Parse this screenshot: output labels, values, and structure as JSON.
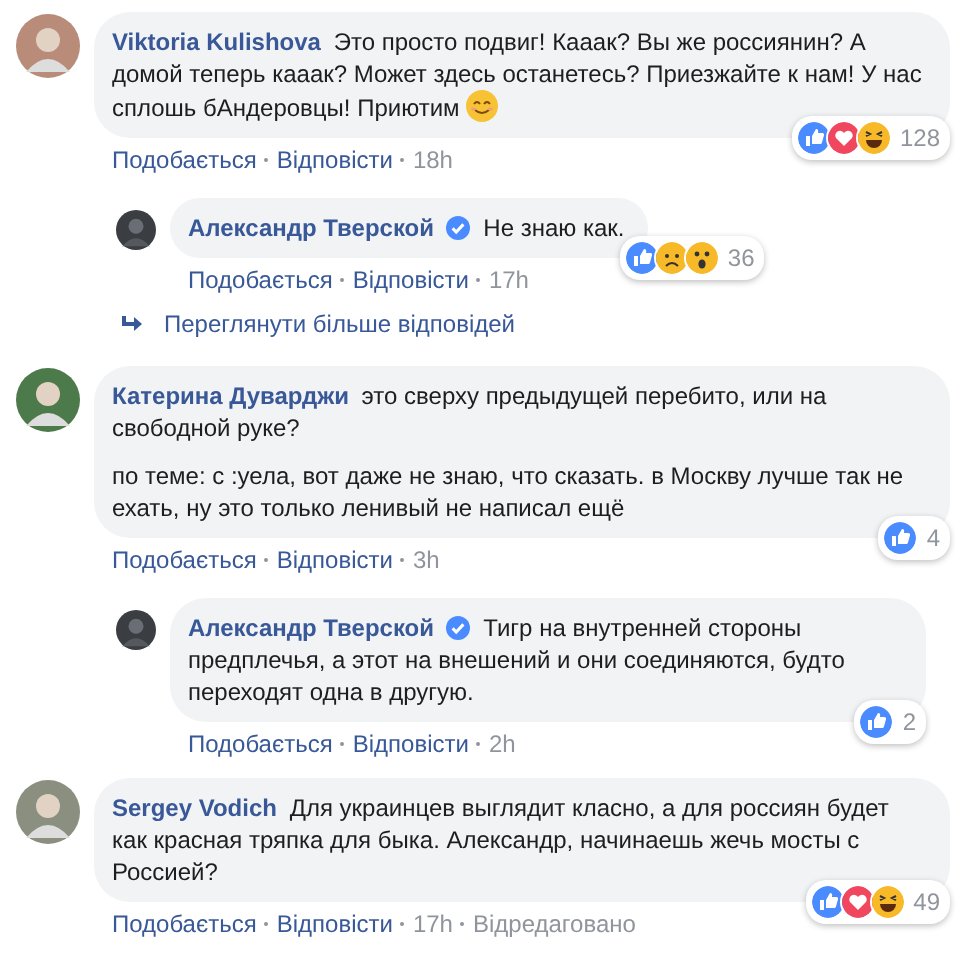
{
  "comments": [
    {
      "author": "Viktoria Kulishova",
      "paragraphs": [
        "Это просто подвиг! Кааак? Вы же россиянин? А домой теперь кааак? Может здесь останетесь? Приезжайте к нам! У нас сплошь бАндеровцы! Приютим"
      ],
      "smiley": true,
      "actions": [
        "Подобається",
        "Відповісти"
      ],
      "time": "18h",
      "reactions": [
        {
          "kind": "like"
        },
        {
          "kind": "love"
        },
        {
          "kind": "haha"
        }
      ],
      "count": "128",
      "more_replies": "Переглянути більше відповідей",
      "replies": [
        {
          "author": "Александр Тверской",
          "verified": true,
          "paragraphs": [
            "Не знаю как."
          ],
          "actions": [
            "Подобається",
            "Відповісти"
          ],
          "time": "17h",
          "reactions": [
            {
              "kind": "like"
            },
            {
              "kind": "sad"
            },
            {
              "kind": "wow"
            }
          ],
          "count": "36"
        }
      ]
    },
    {
      "author": "Катерина Дуварджи",
      "paragraphs": [
        "это сверху предыдущей перебито, или на свободной руке?",
        "по теме: с :уела, вот даже не знаю, что сказать. в Москву лучше так не ехать, ну это только ленивый не написал ещё"
      ],
      "actions": [
        "Подобається",
        "Відповісти"
      ],
      "time": "3h",
      "reactions": [
        {
          "kind": "like"
        }
      ],
      "count": "4",
      "replies": [
        {
          "author": "Александр Тверской",
          "verified": true,
          "paragraphs": [
            "Тигр на внутренней стороны предплечья, а этот на внешений и они соединяются, будто переходят одна в другую."
          ],
          "actions": [
            "Подобається",
            "Відповісти"
          ],
          "time": "2h",
          "reactions": [
            {
              "kind": "like"
            }
          ],
          "count": "2"
        }
      ]
    },
    {
      "author": "Sergey Vodich",
      "paragraphs": [
        "Для украинцев выглядит класно, а для россиян будет как красная тряпка для быка. Александр, начинаешь жечь мосты с Россией?"
      ],
      "actions": [
        "Подобається",
        "Відповісти"
      ],
      "time": "17h",
      "edited": "Відредаговано",
      "reactions": [
        {
          "kind": "like"
        },
        {
          "kind": "love"
        },
        {
          "kind": "haha"
        }
      ],
      "count": "49"
    }
  ]
}
